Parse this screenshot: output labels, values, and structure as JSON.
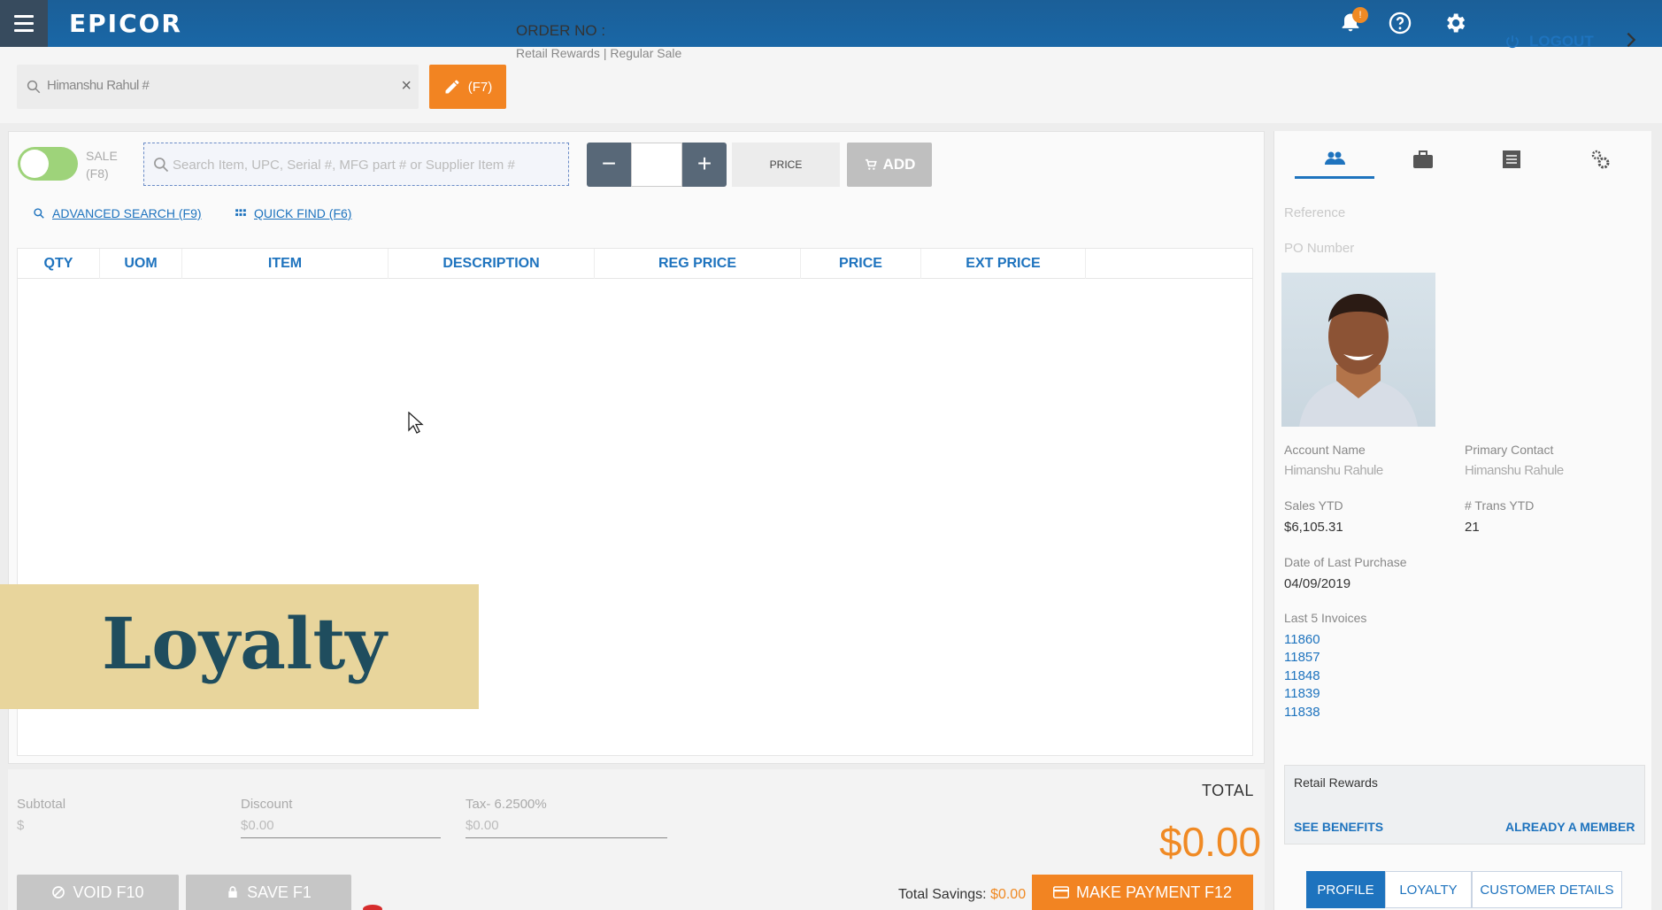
{
  "app": {
    "brand": "EPICOR",
    "bell_badge": "!"
  },
  "header": {
    "customer_search_value": "Himanshu Rahul #",
    "edit_shortcut": "(F7)",
    "order_label": "ORDER NO :",
    "order_sub": "Retail Rewards | Regular Sale",
    "logout_label": "LOGOUT"
  },
  "sale_toggle": {
    "label": "SALE",
    "shortcut": "(F8)",
    "on": true
  },
  "item_search": {
    "placeholder": "Search Item, UPC, Serial #, MFG part # or Supplier Item #"
  },
  "quantity": {
    "minus": "−",
    "plus": "+",
    "value": ""
  },
  "price_button": "PRICE",
  "add_button": "ADD",
  "links": {
    "advanced_search": "ADVANCED SEARCH (F9)",
    "quick_find": "QUICK FIND (F6)"
  },
  "table": {
    "columns": [
      "QTY",
      "UOM",
      "ITEM",
      "DESCRIPTION",
      "REG PRICE",
      "PRICE",
      "EXT PRICE"
    ],
    "rows": []
  },
  "banner": {
    "text": "Loyalty"
  },
  "totals": {
    "subtotal_label": "Subtotal",
    "subtotal_value": "$",
    "discount_label": "Discount",
    "discount_value": "$0.00",
    "tax_label": "Tax- 6.2500%",
    "tax_value": "$0.00",
    "total_label": "TOTAL",
    "total_value": "$0.00",
    "savings_label": "Total Savings:",
    "savings_value": "$0.00"
  },
  "buttons": {
    "void": "VOID F10",
    "save": "SAVE F1",
    "pay": "MAKE PAYMENT F12"
  },
  "customer": {
    "reference_label": "Reference",
    "po_label": "PO Number",
    "account_name_label": "Account Name",
    "account_name": "Himanshu Rahule",
    "primary_contact_label": "Primary Contact",
    "primary_contact": "Himanshu Rahule",
    "sales_ytd_label": "Sales YTD",
    "sales_ytd": "$6,105.31",
    "trans_ytd_label": "# Trans YTD",
    "trans_ytd": "21",
    "last_purchase_label": "Date of Last Purchase",
    "last_purchase": "04/09/2019",
    "invoices_label": "Last 5 Invoices",
    "invoices": [
      "11860",
      "11857",
      "11848",
      "11839",
      "11838"
    ]
  },
  "rewards": {
    "title": "Retail Rewards",
    "see_benefits": "SEE BENEFITS",
    "already_member": "ALREADY A MEMBER"
  },
  "bottom_tabs": [
    "PROFILE",
    "LOYALTY",
    "CUSTOMER DETAILS"
  ],
  "colors": {
    "brand_blue": "#1a67a6",
    "accent_orange": "#f28422",
    "link_blue": "#1e73be",
    "toggle_green": "#9ed37a"
  }
}
